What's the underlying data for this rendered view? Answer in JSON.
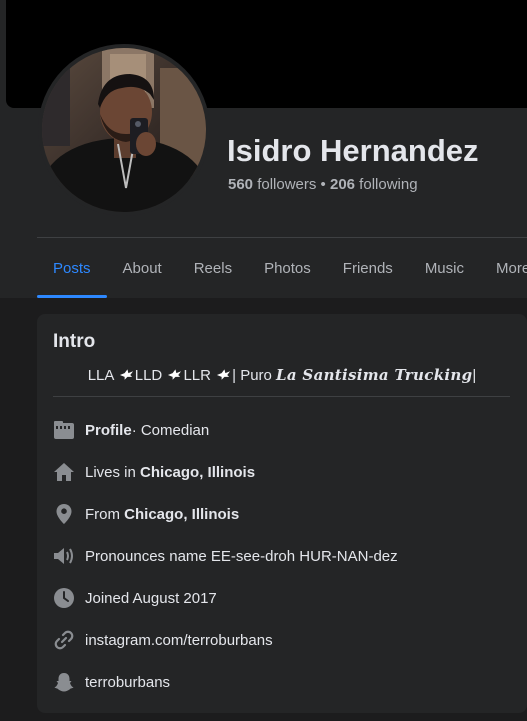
{
  "profile": {
    "name": "Isidro Hernandez",
    "followers_count": "560",
    "followers_label": " followers",
    "separator": " • ",
    "following_count": "206",
    "following_label": " following"
  },
  "tabs": [
    {
      "label": "Posts",
      "active": true
    },
    {
      "label": "About"
    },
    {
      "label": "Reels"
    },
    {
      "label": "Photos"
    },
    {
      "label": "Friends"
    },
    {
      "label": "Music"
    },
    {
      "label": "More"
    }
  ],
  "intro": {
    "title": "Intro",
    "bio": {
      "part1": "LLA ",
      "part2": "LLD ",
      "part3": "LLR ",
      "part4": "| Puro ",
      "fancy": "La Santisima Trucking",
      "end": "|"
    },
    "details": [
      {
        "icon": "briefcase-icon",
        "bold": "Profile",
        "text": " · Comedian"
      },
      {
        "icon": "home-icon",
        "prefix": "Lives in ",
        "bold": "Chicago, Illinois"
      },
      {
        "icon": "location-pin-icon",
        "prefix": "From ",
        "bold": "Chicago, Illinois"
      },
      {
        "icon": "speaker-icon",
        "text": "Pronounces name EE-see-droh HUR-NAN-dez"
      },
      {
        "icon": "clock-icon",
        "text": "Joined August 2017"
      },
      {
        "icon": "link-icon",
        "text": "instagram.com/terroburbans"
      },
      {
        "icon": "snapchat-icon",
        "text": "terroburbans"
      }
    ]
  },
  "colors": {
    "background": "#1c1c1d",
    "card": "#242526",
    "accent": "#2d88ff",
    "text_primary": "#e4e6eb",
    "text_secondary": "#b0b3b8"
  }
}
